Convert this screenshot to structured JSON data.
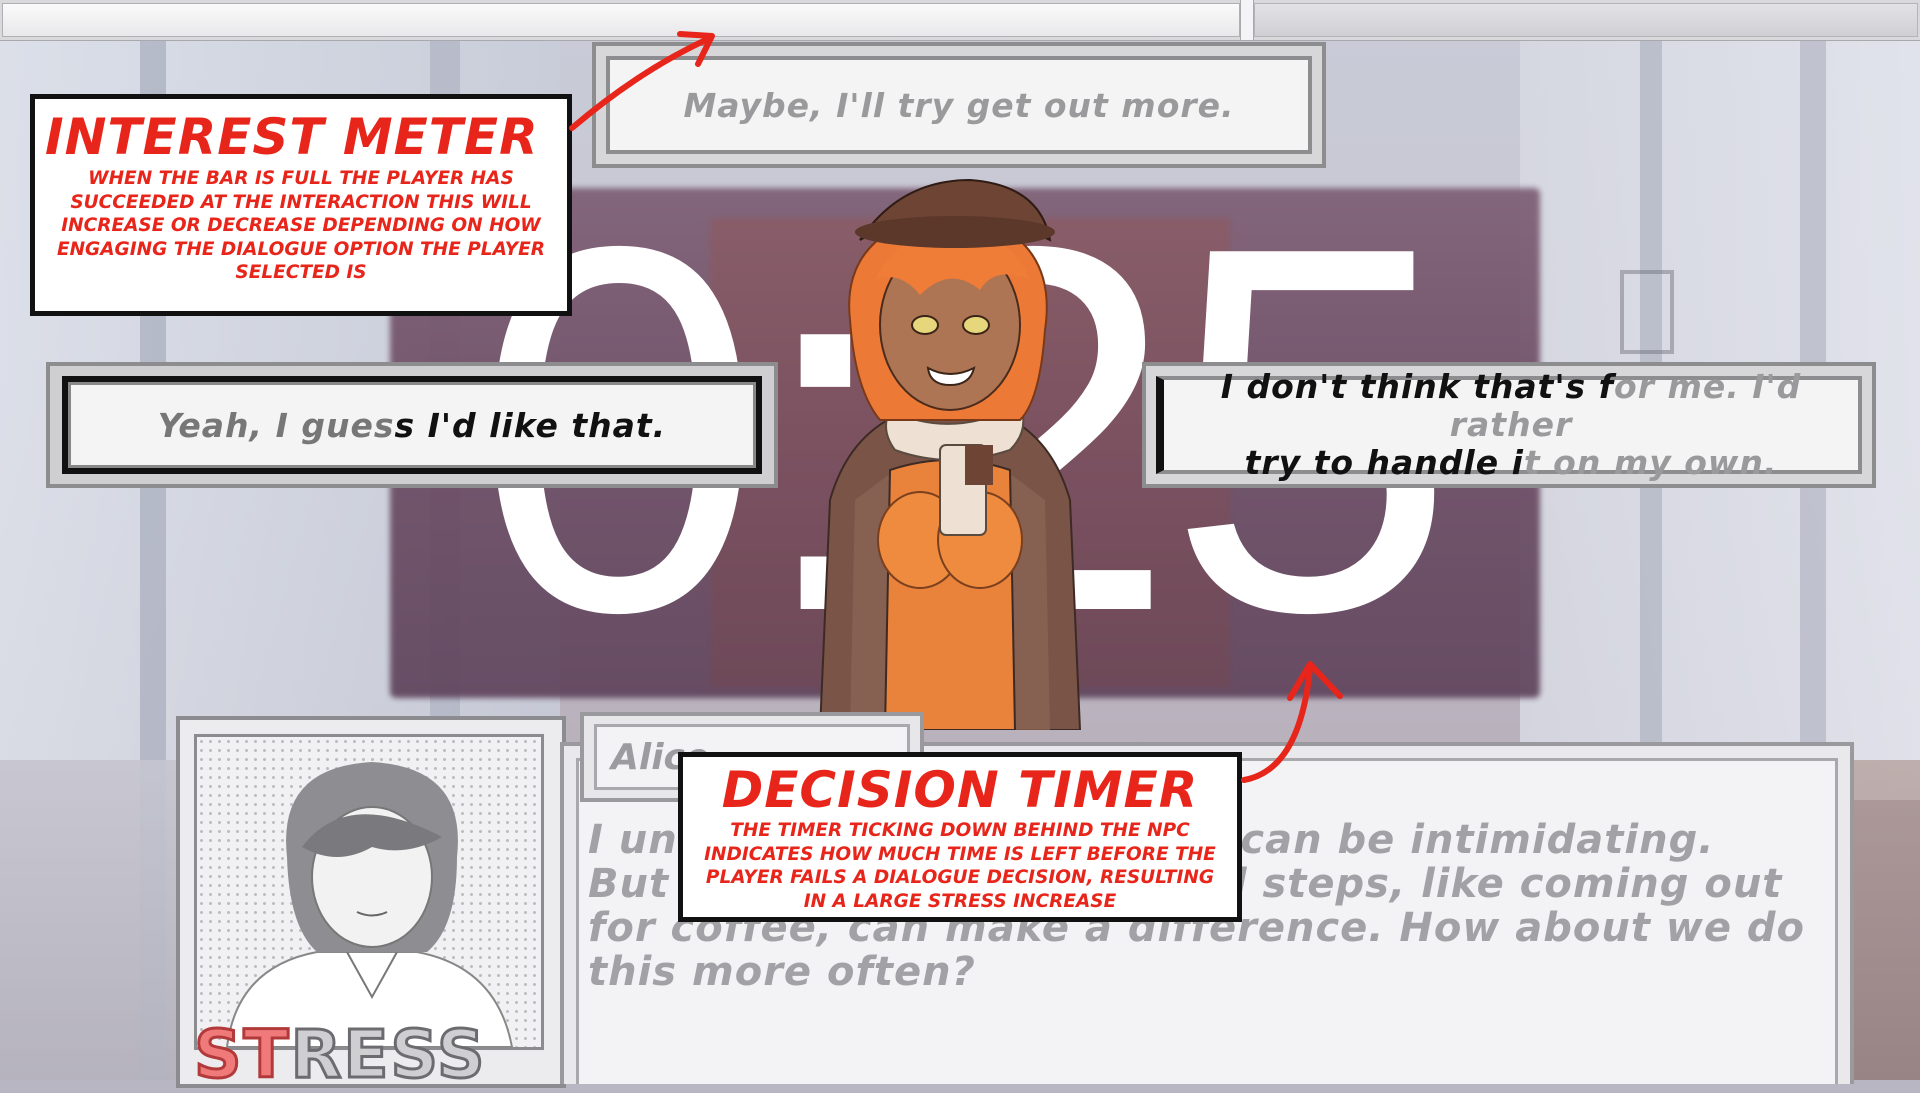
{
  "interest_meter": {
    "fill": 0.645
  },
  "timer": {
    "display": "0:25"
  },
  "options": {
    "top": {
      "text": "Maybe, I'll try get  out more."
    },
    "left": {
      "text_plain": "Yeah, I gues",
      "text_highlight": "s I'd like that."
    },
    "right": {
      "line1_highlight": "I don't think that's f",
      "line1_plain": "or me. I'd rather",
      "line2_highlight": "try to handle i",
      "line2_plain": "t on my own."
    }
  },
  "dialogue": {
    "speaker": "Alice",
    "text": "I understand, and I know it can be intimidating. But starting by taking small steps, like coming out for coffee, can make a difference. How about we do this more often?"
  },
  "stress_label_a": "ST",
  "stress_label_b": "RESS",
  "callouts": {
    "interest": {
      "title": "INTEREST METER",
      "desc": "WHEN THE BAR IS FULL THE PLAYER HAS SUCCEEDED AT THE INTERACTION THIS WILL INCREASE OR DECREASE DEPENDING ON HOW ENGAGING THE DIALOGUE OPTION THE PLAYER SELECTED IS"
    },
    "timer": {
      "title": "DECISION TIMER",
      "desc": "THE TIMER TICKING DOWN BEHIND THE NPC INDICATES HOW MUCH TIME IS LEFT BEFORE THE PLAYER FAILS A DIALOGUE DECISION, RESULTING IN A LARGE STRESS INCREASE"
    }
  },
  "colors": {
    "annotation_red": "#e8251a",
    "timer_white": "#ffffff",
    "stress_red": "#f07a7a"
  }
}
